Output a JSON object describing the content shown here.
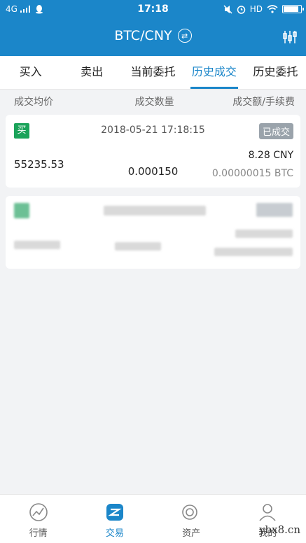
{
  "statusbar": {
    "network": "4G",
    "time": "17:18",
    "hd": "HD"
  },
  "header": {
    "title": "BTC/CNY"
  },
  "tabs": [
    "买入",
    "卖出",
    "当前委托",
    "历史成交",
    "历史委托"
  ],
  "columns": [
    "成交均价",
    "成交数量",
    "成交额/手续费"
  ],
  "trades": [
    {
      "type": "买",
      "datetime": "2018-05-21 17:18:15",
      "status": "已成交",
      "avg_price": "55235.53",
      "quantity": "0.000150",
      "amount": "8.28 CNY",
      "fee": "0.00000015 BTC"
    }
  ],
  "bottom_nav": [
    "行情",
    "交易",
    "资产",
    "我的"
  ],
  "watermark": "ybx8.cn",
  "colors": {
    "primary": "#1b86c9",
    "buy": "#1ba35a",
    "status": "#9aa3ab"
  }
}
